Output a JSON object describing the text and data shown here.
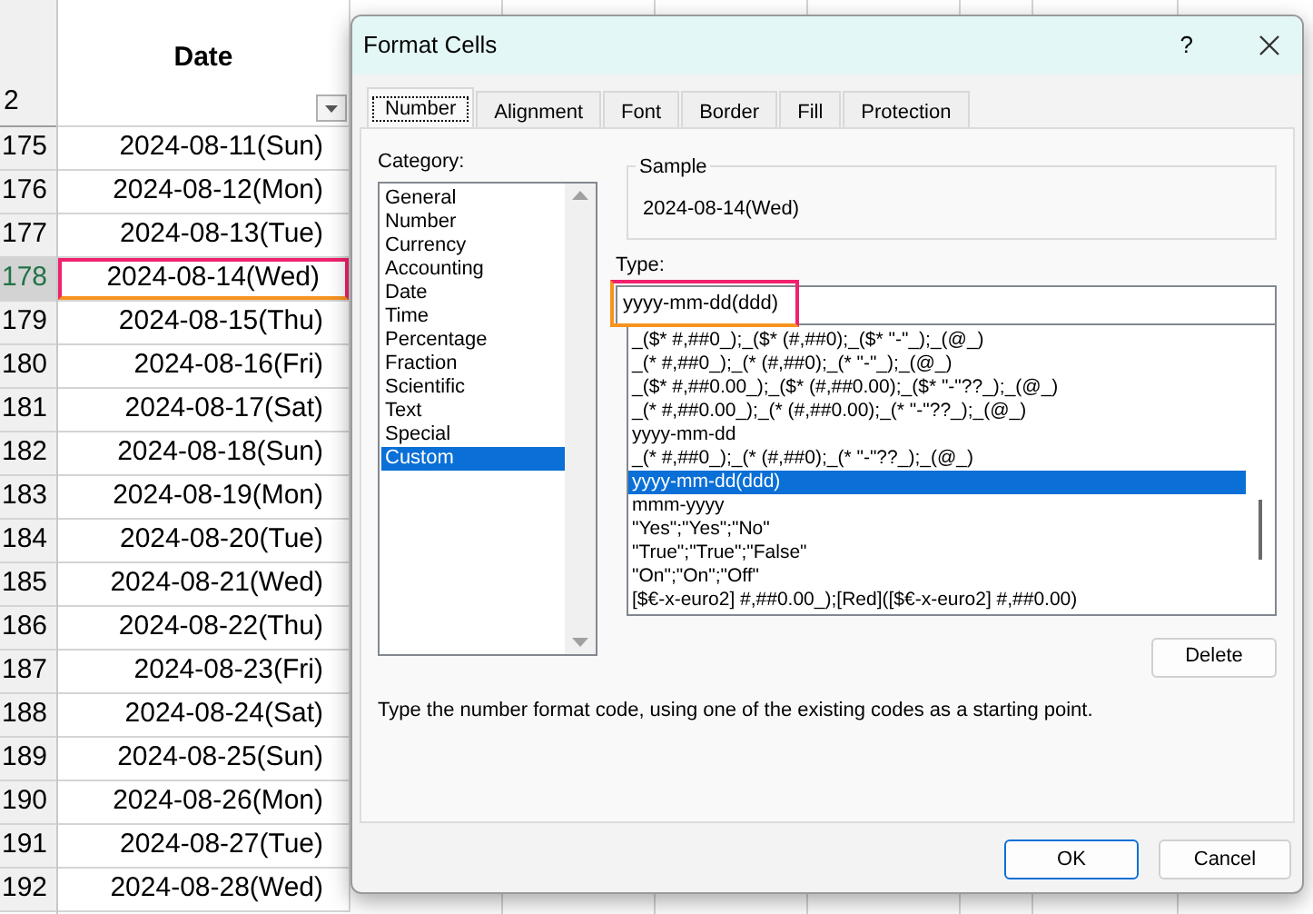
{
  "sheet": {
    "corner_row": "2",
    "column_header": "Date",
    "rows": [
      {
        "num": "175",
        "date": "2024-08-11(Sun)",
        "selected": false
      },
      {
        "num": "176",
        "date": "2024-08-12(Mon)",
        "selected": false
      },
      {
        "num": "177",
        "date": "2024-08-13(Tue)",
        "selected": false
      },
      {
        "num": "178",
        "date": "2024-08-14(Wed)",
        "selected": true
      },
      {
        "num": "179",
        "date": "2024-08-15(Thu)",
        "selected": false
      },
      {
        "num": "180",
        "date": "2024-08-16(Fri)",
        "selected": false
      },
      {
        "num": "181",
        "date": "2024-08-17(Sat)",
        "selected": false
      },
      {
        "num": "182",
        "date": "2024-08-18(Sun)",
        "selected": false
      },
      {
        "num": "183",
        "date": "2024-08-19(Mon)",
        "selected": false
      },
      {
        "num": "184",
        "date": "2024-08-20(Tue)",
        "selected": false
      },
      {
        "num": "185",
        "date": "2024-08-21(Wed)",
        "selected": false
      },
      {
        "num": "186",
        "date": "2024-08-22(Thu)",
        "selected": false
      },
      {
        "num": "187",
        "date": "2024-08-23(Fri)",
        "selected": false
      },
      {
        "num": "188",
        "date": "2024-08-24(Sat)",
        "selected": false
      },
      {
        "num": "189",
        "date": "2024-08-25(Sun)",
        "selected": false
      },
      {
        "num": "190",
        "date": "2024-08-26(Mon)",
        "selected": false
      },
      {
        "num": "191",
        "date": "2024-08-27(Tue)",
        "selected": false
      },
      {
        "num": "192",
        "date": "2024-08-28(Wed)",
        "selected": false
      }
    ]
  },
  "dialog": {
    "title": "Format Cells",
    "help": "?",
    "tabs": [
      {
        "label": "Number",
        "selected": true
      },
      {
        "label": "Alignment",
        "selected": false
      },
      {
        "label": "Font",
        "selected": false
      },
      {
        "label": "Border",
        "selected": false
      },
      {
        "label": "Fill",
        "selected": false
      },
      {
        "label": "Protection",
        "selected": false
      }
    ],
    "category_label": "Category:",
    "categories": [
      {
        "label": "General",
        "selected": false
      },
      {
        "label": "Number",
        "selected": false
      },
      {
        "label": "Currency",
        "selected": false
      },
      {
        "label": "Accounting",
        "selected": false
      },
      {
        "label": "Date",
        "selected": false
      },
      {
        "label": "Time",
        "selected": false
      },
      {
        "label": "Percentage",
        "selected": false
      },
      {
        "label": "Fraction",
        "selected": false
      },
      {
        "label": "Scientific",
        "selected": false
      },
      {
        "label": "Text",
        "selected": false
      },
      {
        "label": "Special",
        "selected": false
      },
      {
        "label": "Custom",
        "selected": true
      }
    ],
    "sample_label": "Sample",
    "sample_value": "2024-08-14(Wed)",
    "type_label": "Type:",
    "type_value": "yyyy-mm-dd(ddd)",
    "type_highlighted": true,
    "formats": [
      {
        "text": "_($* #,##0_);_($* (#,##0);_($* \"-\"_);_(@_)",
        "selected": false
      },
      {
        "text": "_(* #,##0_);_(* (#,##0);_(* \"-\"_);_(@_)",
        "selected": false
      },
      {
        "text": "_($* #,##0.00_);_($* (#,##0.00);_($* \"-\"??_);_(@_)",
        "selected": false
      },
      {
        "text": "_(* #,##0.00_);_(* (#,##0.00);_(* \"-\"??_);_(@_)",
        "selected": false
      },
      {
        "text": "yyyy-mm-dd",
        "selected": false
      },
      {
        "text": "_(* #,##0_);_(* (#,##0);_(* \"-\"??_);_(@_)",
        "selected": false
      },
      {
        "text": "yyyy-mm-dd(ddd)",
        "selected": true
      },
      {
        "text": "mmm-yyyy",
        "selected": false
      },
      {
        "text": "\"Yes\";\"Yes\";\"No\"",
        "selected": false
      },
      {
        "text": "\"True\";\"True\";\"False\"",
        "selected": false
      },
      {
        "text": "\"On\";\"On\";\"Off\"",
        "selected": false
      },
      {
        "text": "[$€-x-euro2] #,##0.00_);[Red]([$€-x-euro2] #,##0.00)",
        "selected": false
      }
    ],
    "delete_button": "Delete",
    "hint": "Type the number format code, using one of the existing codes as a starting point.",
    "ok_button": "OK",
    "cancel_button": "Cancel"
  }
}
